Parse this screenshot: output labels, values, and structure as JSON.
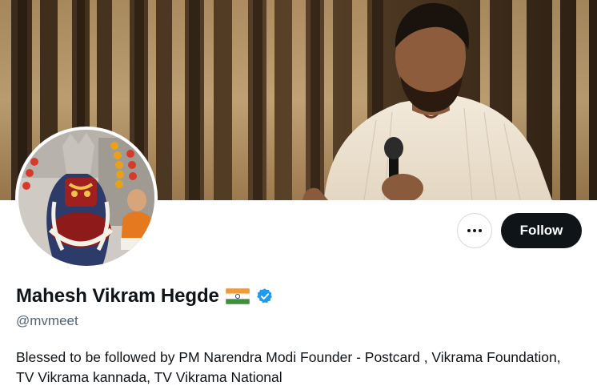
{
  "profile": {
    "display_name": "Mahesh Vikram Hegde",
    "handle": "@mvmeet",
    "bio": "Blessed to be followed by PM Narendra Modi Founder - Postcard , Vikrama Foundation, TV Vikrama kannada, TV Vikrama National",
    "flag_icon": "india-flag-icon",
    "verified_icon": "verified-badge-icon"
  },
  "actions": {
    "more_icon": "more-options-icon",
    "follow_label": "Follow"
  },
  "colors": {
    "text_primary": "#0f1419",
    "text_secondary": "#536471",
    "follow_bg": "#0f1419",
    "verified_blue": "#1d9bf0",
    "border": "#cfd9de"
  }
}
